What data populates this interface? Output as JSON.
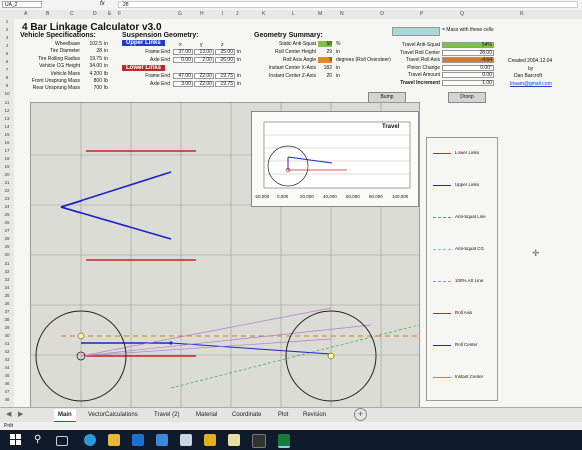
{
  "formula_bar": {
    "name_box": "UA_2",
    "formula": "28"
  },
  "columns": [
    "A",
    "B",
    "C",
    "D",
    "E",
    "F",
    "G",
    "H",
    "I",
    "J",
    "K",
    "L",
    "M",
    "N",
    "O",
    "P",
    "Q",
    "R"
  ],
  "rows": [
    "1",
    "2",
    "3",
    "4",
    "5",
    "6",
    "7",
    "8",
    "9",
    "10",
    "11",
    "12",
    "13",
    "14",
    "15",
    "16",
    "17",
    "18",
    "19",
    "20",
    "21",
    "22",
    "23",
    "24",
    "25",
    "26",
    "27",
    "28",
    "29",
    "30",
    "31",
    "32",
    "33",
    "34",
    "35",
    "36",
    "37",
    "38",
    "39",
    "40",
    "41",
    "42",
    "43",
    "44",
    "45",
    "46",
    "47",
    "48"
  ],
  "title": "4 Bar Linkage Calculator v3.0",
  "note": "= Mass with these cells",
  "vehicle": {
    "heading": "Vehicle Specifications:",
    "rows": [
      {
        "label": "Wheelbase",
        "value": "102.5",
        "unit": "in"
      },
      {
        "label": "Tire Diameter",
        "value": "28",
        "unit": "in"
      },
      {
        "label": "Tire Rolling Radius",
        "value": "19.75",
        "unit": "in"
      },
      {
        "label": "Vehicle CG Height",
        "value": "34.00",
        "unit": "in"
      },
      {
        "label": "Vehicle Mass",
        "value": "4 200",
        "unit": "lb"
      },
      {
        "label": "Front Unsprung Mass",
        "value": "800",
        "unit": "lb"
      },
      {
        "label": "Rear Unsprung Mass",
        "value": "700",
        "unit": "lb"
      }
    ]
  },
  "suspension": {
    "heading": "Suspension Geometry:",
    "col_x": "x",
    "col_y": "y",
    "col_z": "z",
    "upper": {
      "label": "Upper Links",
      "rows": [
        {
          "label": "Frame End",
          "x": "37.00",
          "y": "13.00",
          "z": "25.00",
          "unit": "in"
        },
        {
          "label": "Axle End",
          "x": "0.00",
          "y": "2.00",
          "z": "26.00",
          "unit": "in"
        }
      ]
    },
    "lower": {
      "label": "Lower Links",
      "rows": [
        {
          "label": "Frame End",
          "x": "47.00",
          "y": "22.00",
          "z": "19.75",
          "unit": "in"
        },
        {
          "label": "Axle End",
          "x": "3.00",
          "y": "22.00",
          "z": "19.75",
          "unit": "in"
        }
      ]
    }
  },
  "geometry": {
    "heading": "Geometry Summary:",
    "rows": [
      {
        "label": "Static Anti-Squat",
        "value": "58",
        "unit": "%"
      },
      {
        "label": "Roll Center Height",
        "value": "29",
        "unit": "in"
      },
      {
        "label": "Roll Axis Angle",
        "value": "9",
        "unit": "degrees (Roll Oversteer)"
      },
      {
        "label": "Instant Center X-Axis",
        "value": "182",
        "unit": "in"
      },
      {
        "label": "Instant Center Z-Axis",
        "value": "20",
        "unit": "in"
      }
    ]
  },
  "travel_panel": {
    "rows": [
      {
        "label": "Travel Anti-Squat",
        "value": "54%"
      },
      {
        "label": "Travel Roll Center",
        "value": "28.00"
      },
      {
        "label": "Travel Roll Axis",
        "value": "-4.64"
      },
      {
        "label": "Pinion Change",
        "value": "0.00°"
      },
      {
        "label": "Travel Amount",
        "value": "0.00"
      },
      {
        "label": "Travel Increment",
        "value": "1.00"
      }
    ],
    "bump": "Bump",
    "droop": "Droop"
  },
  "credits": {
    "created": "Created 2004.12.04",
    "by": "by",
    "author": "Dan Barcroft",
    "email": "triaam@gmail.com"
  },
  "inset_chart": {
    "title": "Travel",
    "ticks": [
      "-20,000",
      "0,000",
      "20,000",
      "40,000",
      "60,000",
      "80,000",
      "100,000"
    ]
  },
  "legend": [
    {
      "name": "Lower Links",
      "color": "#d0201f"
    },
    {
      "name": "Upper Links",
      "color": "#1b25c8"
    },
    {
      "name": "Anti-Squat Line",
      "color": "#2fb34a"
    },
    {
      "name": "Anti-Squat CG",
      "color": "#6fc3e8"
    },
    {
      "name": "100% AS Line",
      "color": "#b07fd0"
    },
    {
      "name": "Roll Axis",
      "color": "#d0201f"
    },
    {
      "name": "Roll Center",
      "color": "#1b25c8"
    },
    {
      "name": "Instant Center",
      "color": "#e07a1f"
    }
  ],
  "tabs": [
    "Main",
    "VectorCalculations",
    "Travel (2)",
    "Material",
    "Coordinate",
    "Plot",
    "Revision"
  ],
  "status": "Prêt",
  "colors": {
    "excel_green": "#1a7a3a",
    "upper": "#1b25c8",
    "lower": "#d0201f"
  }
}
